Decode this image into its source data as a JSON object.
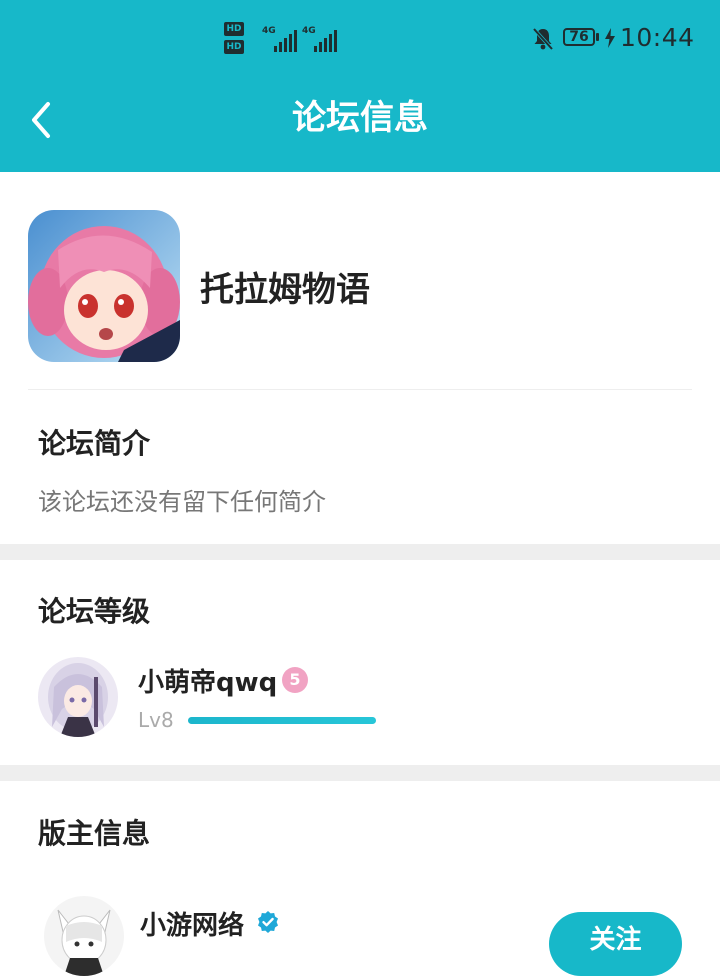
{
  "status_bar": {
    "hd_badges": [
      "HD",
      "HD"
    ],
    "network_labels": [
      "4G",
      "4G"
    ],
    "battery": "76",
    "time": "10:44",
    "icons": [
      "hd-icon",
      "signal-icon",
      "mute-icon",
      "battery-icon",
      "charging-icon"
    ]
  },
  "header": {
    "title": "论坛信息",
    "back_icon": "chevron-left-icon"
  },
  "forum": {
    "name": "托拉姆物语",
    "icon": "forum-avatar"
  },
  "intro": {
    "title": "论坛简介",
    "text": "该论坛还没有留下任何简介"
  },
  "level_section": {
    "title": "论坛等级",
    "user": {
      "name": "小萌帝qwq",
      "badge": "5",
      "level": "Lv8",
      "progress": 1.0
    }
  },
  "moderator_section": {
    "title": "版主信息",
    "moderator": {
      "name": "小游网络",
      "verified_icon": "verified-icon",
      "follow_label": "关注"
    }
  },
  "colors": {
    "accent": "#17b8c9",
    "divider": "#eeeeee",
    "badge": "#f1a3c3"
  }
}
